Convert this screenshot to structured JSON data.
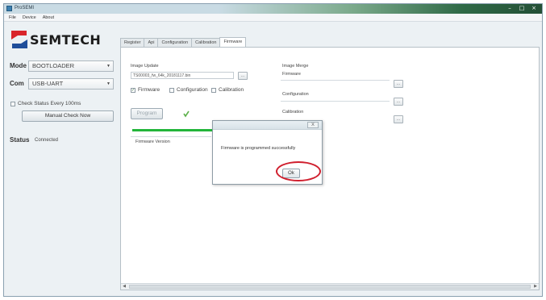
{
  "window": {
    "title": "ProSEMI",
    "controls": {
      "minimize": "–",
      "restore": "□",
      "close": "×"
    }
  },
  "menu": [
    "File",
    "Device",
    "About"
  ],
  "logo": {
    "text": "SEMTECH"
  },
  "left_panel": {
    "mode_label": "Mode",
    "mode_value": "BOOTLOADER",
    "com_label": "Com",
    "com_value": "USB-UART",
    "check_status_label": "Check Status Every 100ms",
    "manual_check_label": "Manual Check Now",
    "status_label": "Status",
    "status_value": "Connected"
  },
  "tabs": [
    "Register",
    "Api",
    "Configuration",
    "Calibration",
    "Firmware"
  ],
  "active_tab": "Firmware",
  "firmware": {
    "image_update_label": "Image Update",
    "image_file": "TS00003_fw_64k_20181117.bin",
    "checkbox_firmware": "Firmware",
    "checkbox_configuration": "Configuration",
    "checkbox_calibration": "Calibration",
    "program_button": "Program",
    "firmware_version_label": "Firmware Version",
    "browse_label": "...",
    "image_merge_label": "Image Merge",
    "merge_firmware_label": "Firmware",
    "merge_configuration_label": "Configuration",
    "merge_calibration_label": "Calibration"
  },
  "dialog": {
    "close_label": "X",
    "message": "Firmware is programmed successfully",
    "ok_label": "Ok"
  },
  "colors": {
    "progress": "#22b53a",
    "highlight": "#d01f2e",
    "logo_red": "#d9252b",
    "logo_blue": "#1f4e9a"
  }
}
